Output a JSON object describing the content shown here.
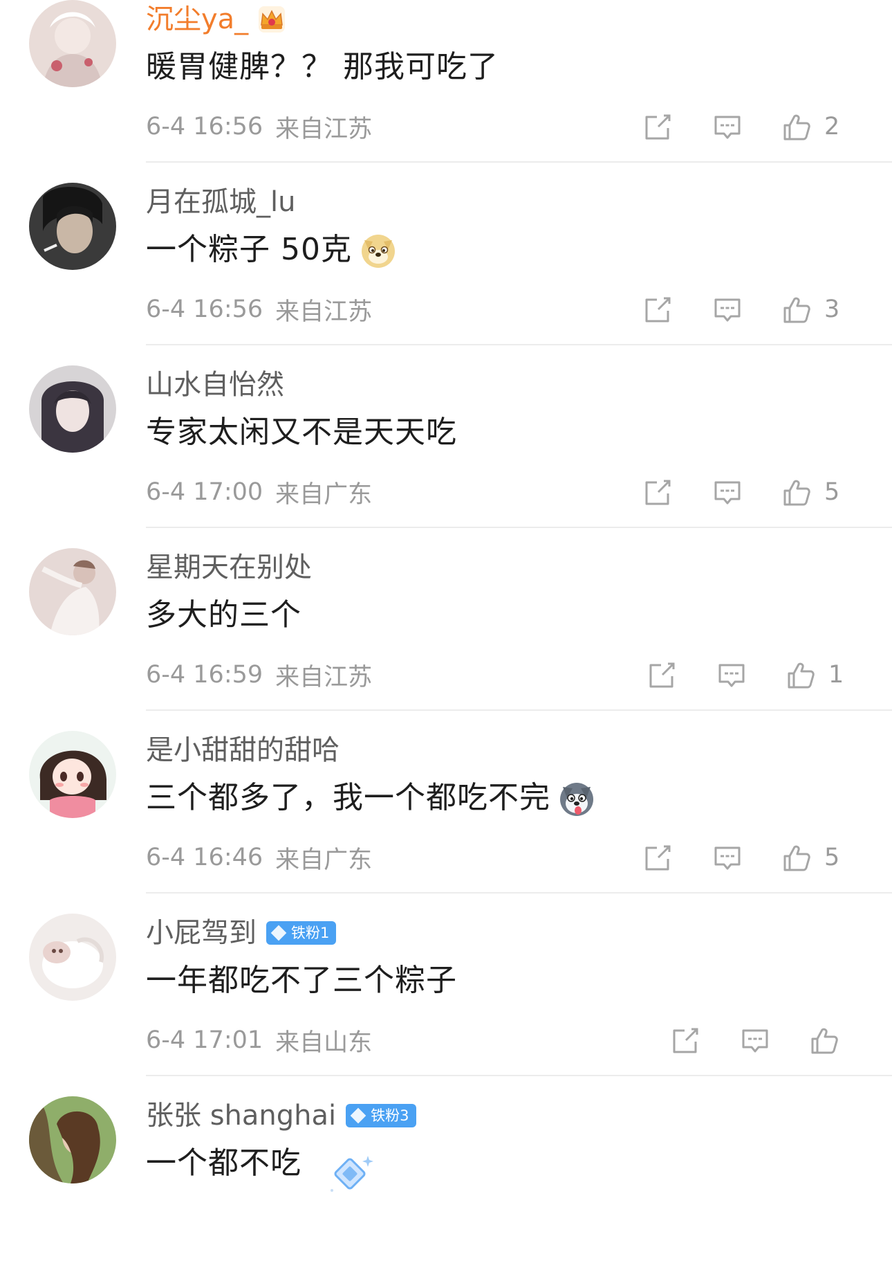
{
  "comments": [
    {
      "username": "沉尘ya_",
      "username_color": "#f27d2c",
      "badge": "crown-icon",
      "text": "暖胃健脾？？ 那我可吃了",
      "emoji": "",
      "time": "6-4 16:56",
      "location": "来自江苏",
      "likes": "2"
    },
    {
      "username": "月在孤城_lu",
      "text": "一个粽子 50克",
      "emoji": "doge-emoji-icon",
      "time": "6-4 16:56",
      "location": "来自江苏",
      "likes": "3"
    },
    {
      "username": "山水自怡然",
      "text": "专家太闲又不是天天吃",
      "emoji": "",
      "time": "6-4 17:00",
      "location": "来自广东",
      "likes": "5"
    },
    {
      "username": "星期天在别处",
      "text": "多大的三个",
      "emoji": "",
      "time": "6-4 16:59",
      "location": "来自江苏",
      "likes": "1"
    },
    {
      "username": "是小甜甜的甜哈",
      "text": "三个都多了，我一个都吃不完",
      "emoji": "husky-emoji-icon",
      "time": "6-4 16:46",
      "location": "来自广东",
      "likes": "5"
    },
    {
      "username": "小屁驾到",
      "badge_text": "铁粉1",
      "text": "一年都吃不了三个粽子",
      "emoji": "",
      "time": "6-4 17:01",
      "location": "来自山东",
      "likes": ""
    },
    {
      "username": "张张 shanghai",
      "badge_text": "铁粉3",
      "text": "一个都不吃",
      "emoji": "",
      "time": "",
      "location": "",
      "likes": ""
    }
  ],
  "colors": {
    "meta_text": "#9a9a9a",
    "username": "#5f5f5f",
    "vip_username": "#f27d2c",
    "fan_badge": "#4aa1f3",
    "divider": "#ececec"
  },
  "icons": {
    "repost": "repost-icon",
    "comment": "comment-icon",
    "like": "thumbs-up-icon"
  }
}
